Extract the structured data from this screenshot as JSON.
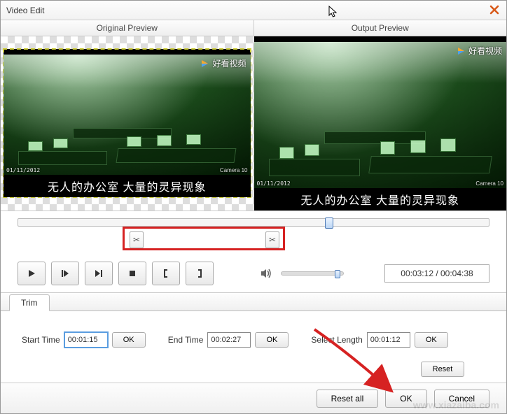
{
  "window": {
    "title": "Video Edit"
  },
  "preview": {
    "original_label": "Original Preview",
    "output_label": "Output Preview",
    "watermark_text": "好看视频",
    "timestamp_text": "01/11/2012",
    "camera_label": "Camera 10",
    "subtitle_text": "无人的办公室 大量的灵异现象"
  },
  "controls": {
    "time_display": "00:03:12 / 00:04:38"
  },
  "tabs": {
    "trim": "Trim"
  },
  "trim": {
    "start_label": "Start Time",
    "start_value": "00:01:15",
    "start_ok": "OK",
    "end_label": "End Time",
    "end_value": "00:02:27",
    "end_ok": "OK",
    "select_label": "Select Length",
    "select_value": "00:01:12",
    "select_ok": "OK",
    "reset": "Reset"
  },
  "footer": {
    "reset_all": "Reset all",
    "ok": "OK",
    "cancel": "Cancel"
  },
  "watermark_site": "www.xiazaiba.com"
}
